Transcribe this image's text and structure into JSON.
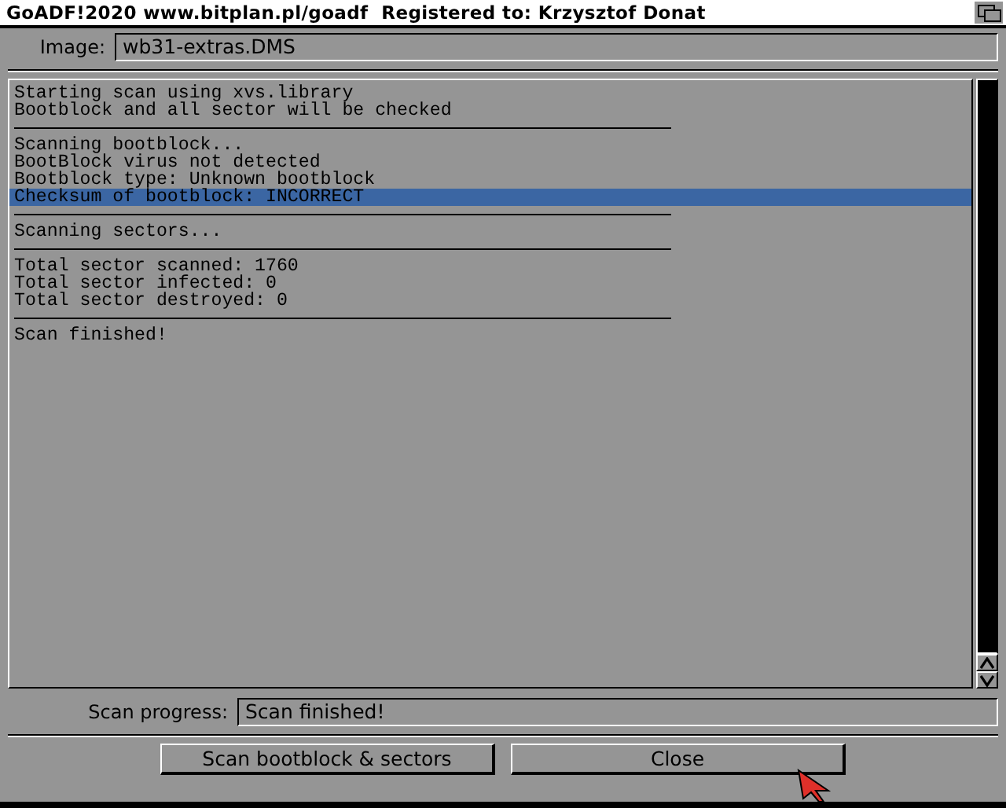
{
  "window": {
    "title": "GoADF!2020 www.bitplan.pl/goadf  Registered to: Krzysztof Donat"
  },
  "image": {
    "label": "Image:",
    "value": "wb31-extras.DMS"
  },
  "log": [
    {
      "kind": "text",
      "text": "Starting scan using xvs.library",
      "selected": false
    },
    {
      "kind": "text",
      "text": "Bootblock and all sector will be checked",
      "selected": false
    },
    {
      "kind": "separator"
    },
    {
      "kind": "text",
      "text": "Scanning bootblock...",
      "selected": false
    },
    {
      "kind": "text",
      "text": "BootBlock virus not detected",
      "selected": false
    },
    {
      "kind": "text",
      "text": "Bootblock type: Unknown bootblock",
      "selected": false
    },
    {
      "kind": "text",
      "text": "Checksum of bootblock: INCORRECT",
      "selected": true
    },
    {
      "kind": "separator"
    },
    {
      "kind": "text",
      "text": "Scanning sectors...",
      "selected": false
    },
    {
      "kind": "separator"
    },
    {
      "kind": "text",
      "text": "Total sector scanned: 1760",
      "selected": false
    },
    {
      "kind": "text",
      "text": "Total sector infected: 0",
      "selected": false
    },
    {
      "kind": "text",
      "text": "Total sector destroyed: 0",
      "selected": false
    },
    {
      "kind": "separator"
    },
    {
      "kind": "text",
      "text": "Scan finished!",
      "selected": false
    }
  ],
  "progress": {
    "label": "Scan progress:",
    "value": "Scan finished!"
  },
  "buttons": [
    "Scan bootblock & sectors",
    "Close"
  ]
}
